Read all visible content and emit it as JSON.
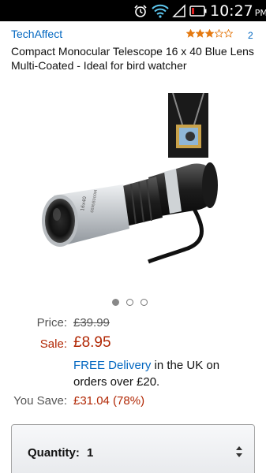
{
  "status_bar": {
    "time": "10:27",
    "ampm": "PM",
    "icons": [
      "alarm-icon",
      "wifi-icon",
      "signal-icon",
      "battery-icon"
    ]
  },
  "product": {
    "brand": "TechAffect",
    "rating": {
      "stars": 3,
      "out_of": 5,
      "review_count": "2"
    },
    "title": "Compact Monocular Telescope 16 x 40 Blue Lens Multi-Coated - Ideal for bird watcher"
  },
  "carousel": {
    "count": 3,
    "active_index": 0
  },
  "pricing": {
    "price_label": "Price:",
    "price_original": "£39.99",
    "sale_label": "Sale:",
    "sale_price": "£8.95",
    "delivery_link": "FREE Delivery",
    "delivery_rest": " in the UK on orders over £20.",
    "save_label": "You Save:",
    "save_value": "£31.04 (78%)"
  },
  "quantity": {
    "label": "Quantity:",
    "value": "1"
  },
  "colors": {
    "link": "#0066c0",
    "sale": "#b12704",
    "star": "#e47911",
    "status_bar": "#000000"
  }
}
